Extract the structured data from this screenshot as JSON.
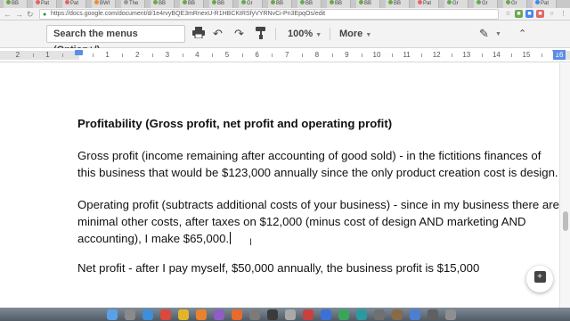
{
  "browser": {
    "tabs": [
      {
        "label": "BB",
        "color": "#6aa84f"
      },
      {
        "label": "Pat",
        "color": "#e06666"
      },
      {
        "label": "Pat",
        "color": "#e06666"
      },
      {
        "label": "BWI",
        "color": "#e69138"
      },
      {
        "label": "The",
        "color": "#999999"
      },
      {
        "label": "BB",
        "color": "#6aa84f"
      },
      {
        "label": "BB",
        "color": "#6aa84f"
      },
      {
        "label": "BB",
        "color": "#6aa84f"
      },
      {
        "label": "Gr",
        "color": "#6aa84f"
      },
      {
        "label": "BB",
        "color": "#6aa84f"
      },
      {
        "label": "BB",
        "color": "#6aa84f"
      },
      {
        "label": "BB",
        "color": "#6aa84f"
      },
      {
        "label": "BB",
        "color": "#6aa84f"
      },
      {
        "label": "BB",
        "color": "#6aa84f"
      },
      {
        "label": "Pat",
        "color": "#e06666"
      },
      {
        "label": "Gr",
        "color": "#6aa84f"
      },
      {
        "label": "Gr",
        "color": "#6aa84f"
      },
      {
        "label": "Gr",
        "color": "#6aa84f"
      },
      {
        "label": "Pat",
        "color": "#4a86e8"
      }
    ],
    "url": "https://docs.google.com/document/d/1e4rvyBQE3mRnexU-R1HBCKtRSfyVYRNvCi-Pn3EpqOs/edit"
  },
  "toolbar": {
    "search_menus": "Search the menus (Option+/)",
    "zoom": "100%",
    "more": "More"
  },
  "ruler": {
    "left_labels": [
      "2",
      "1"
    ],
    "labels": [
      "1",
      "2",
      "3",
      "4",
      "5",
      "6",
      "7",
      "8",
      "9",
      "10",
      "11",
      "12",
      "13",
      "14",
      "15"
    ],
    "right_label": "16"
  },
  "document": {
    "heading": "Profitability (Gross profit, net profit and operating profit)",
    "gross_line1": "Gross profit (income remaining after accounting of good sold) - in the fictitions finances of",
    "gross_line2": "this business that would be $123,000 annually since the only product creation cost is design.",
    "op_line1": "Operating profit (subtracts additional costs of your business) - since in my business there are",
    "op_line2": "minimal other costs, after taxes on $12,000 (minus cost of design AND marketing AND",
    "op_line3": "accounting), I make $65,000.",
    "net_line": "Net profit - after I pay myself, $50,000 annually, the business profit is $15,000"
  },
  "dock_icons": [
    {
      "name": "finder",
      "color": "#5aa0e6"
    },
    {
      "name": "launchpad",
      "color": "#8a8a8a"
    },
    {
      "name": "safari",
      "color": "#3d8fd8"
    },
    {
      "name": "chrome",
      "color": "#d9493c"
    },
    {
      "name": "app-yellow",
      "color": "#e2b52a"
    },
    {
      "name": "app-orange",
      "color": "#e8822c"
    },
    {
      "name": "app-purple",
      "color": "#8e5fc2"
    },
    {
      "name": "firefox",
      "color": "#e86a2c"
    },
    {
      "name": "app-gray",
      "color": "#7b7b7b"
    },
    {
      "name": "app-dark",
      "color": "#3b3b3b"
    },
    {
      "name": "app-lightgray",
      "color": "#a9a9a9"
    },
    {
      "name": "app-red",
      "color": "#c94040"
    },
    {
      "name": "app-blue",
      "color": "#3d6fd8"
    },
    {
      "name": "app-green",
      "color": "#3aa55a"
    },
    {
      "name": "app-teal",
      "color": "#2b9aa0"
    },
    {
      "name": "app-gray2",
      "color": "#707070"
    },
    {
      "name": "app-brown",
      "color": "#8a6a48"
    },
    {
      "name": "app-blue2",
      "color": "#4b7fcf"
    },
    {
      "name": "app-gray3",
      "color": "#606060"
    },
    {
      "name": "app-gray4",
      "color": "#8f8f8f"
    }
  ]
}
